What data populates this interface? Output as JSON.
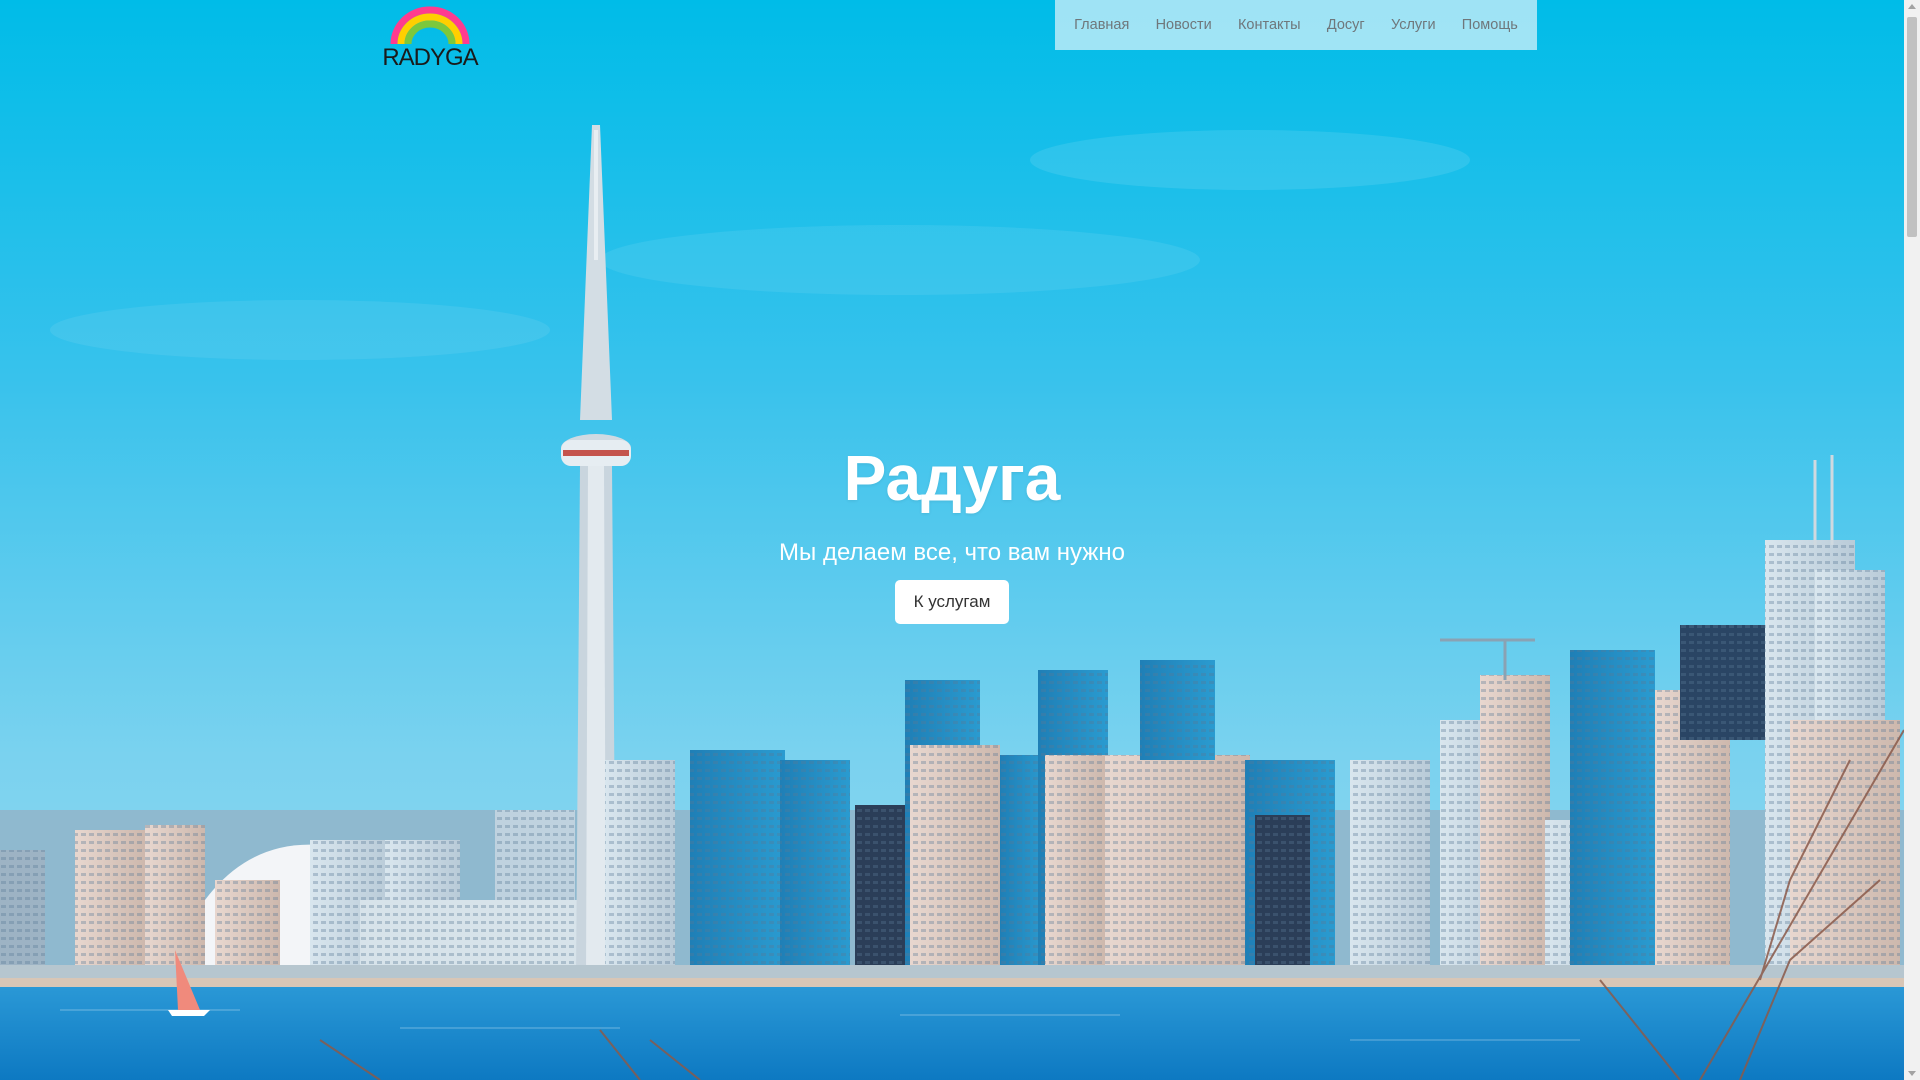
{
  "brand": {
    "logo_text": "RADYGA"
  },
  "nav": {
    "items": [
      {
        "label": "Главная"
      },
      {
        "label": "Новости"
      },
      {
        "label": "Контакты"
      },
      {
        "label": "Досуг"
      },
      {
        "label": "Услуги"
      },
      {
        "label": "Помощь"
      }
    ]
  },
  "hero": {
    "title": "Радуга",
    "subtitle": "Мы делаем все, что вам нужно",
    "button_label": "К услугам",
    "background_image": "city-skyline-photo"
  },
  "colors": {
    "sky_top": "#00bce8",
    "sky_mid": "#59c6ec",
    "water": "#1d8fd1",
    "nav_bg": "#dcf3fa",
    "nav_text": "#6f777b",
    "button_bg": "#ffffff",
    "text_white": "#ffffff"
  },
  "icons": {
    "logo": "rainbow-icon",
    "scroll_up": "chevron-up-icon",
    "scroll_down": "chevron-down-icon"
  }
}
